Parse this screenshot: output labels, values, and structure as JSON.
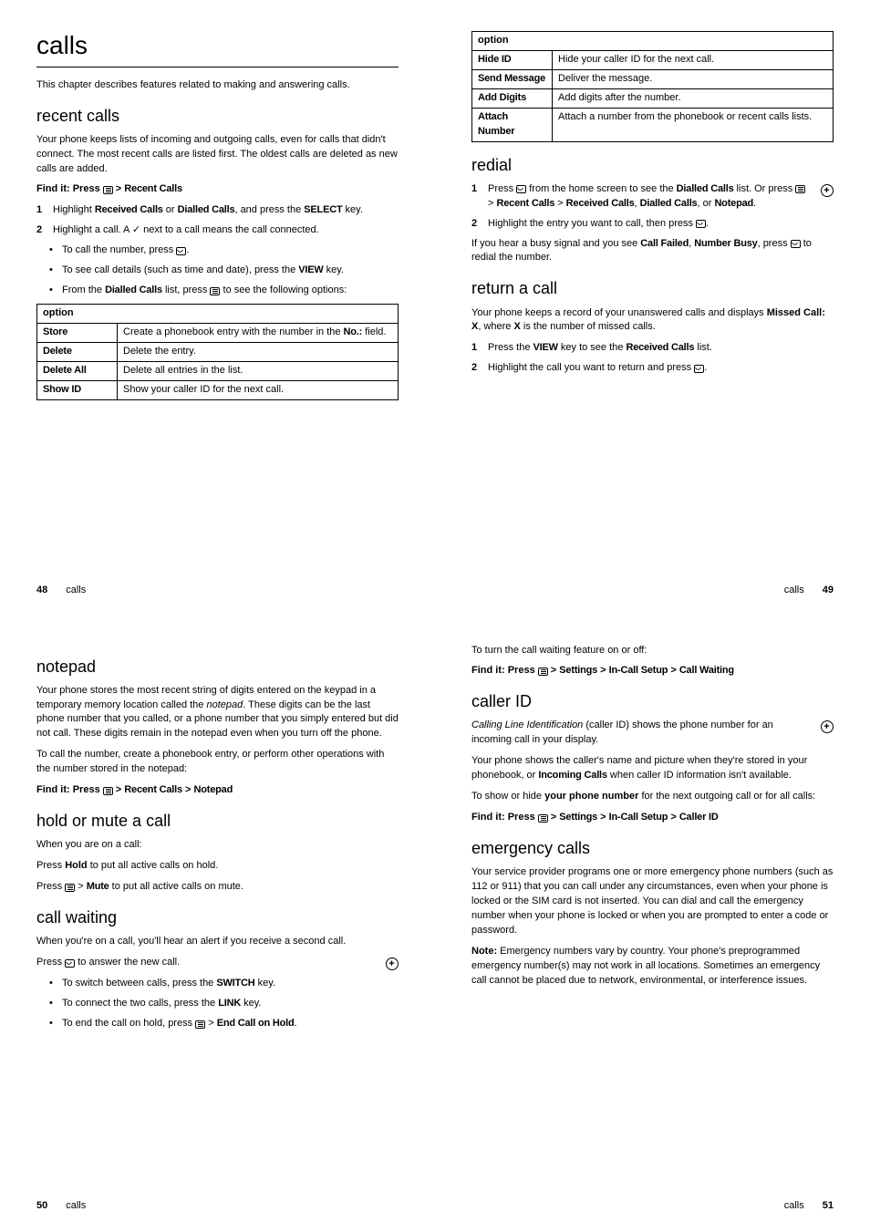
{
  "page48": {
    "h1": "calls",
    "intro": "This chapter describes features related to making and answering calls.",
    "h2": "recent calls",
    "p1": "Your phone keeps lists of incoming and outgoing calls, even for calls that didn't connect. The most recent calls are listed first. The oldest calls are deleted as new calls are added.",
    "find_label": "Find it:",
    "find_text1": " Press ",
    "find_text2": " > ",
    "find_recent": "Recent Calls",
    "step1_a": "Highlight ",
    "step1_b": "Received Calls",
    "step1_c": " or ",
    "step1_d": "Dialled Calls",
    "step1_e": ", and press the ",
    "step1_f": "SELECT",
    "step1_g": " key.",
    "step2_a": "Highlight a call. A ✓ next to a call means the call connected.",
    "bullet1_a": "To call the number, press ",
    "bullet1_b": ".",
    "bullet2_a": "To see call details (such as time and date), press the ",
    "bullet2_b": "VIEW",
    "bullet2_c": " key.",
    "bullet3_a": "From the ",
    "bullet3_b": "Dialled Calls",
    "bullet3_c": " list, press ",
    "bullet3_d": " to see the following options:",
    "table": {
      "header": "option",
      "rows": [
        {
          "opt": "Store",
          "desc_a": "Create a phonebook entry with the number in the ",
          "desc_b": "No.:",
          "desc_c": " field."
        },
        {
          "opt": "Delete",
          "desc_a": "Delete the entry."
        },
        {
          "opt": "Delete All",
          "desc_a": "Delete all entries in the list."
        },
        {
          "opt": "Show ID",
          "desc_a": "Show your caller ID for the next call."
        }
      ]
    },
    "pagenum": "48",
    "pagelabel": "calls"
  },
  "page49": {
    "table": {
      "header": "option",
      "rows": [
        {
          "opt": "Hide ID",
          "desc": "Hide your caller ID for the next call."
        },
        {
          "opt": "Send Message",
          "desc": "Deliver the message."
        },
        {
          "opt": "Add Digits",
          "desc": "Add digits after the number."
        },
        {
          "opt": "Attach Number",
          "desc": "Attach a number from the phonebook or recent calls lists."
        }
      ]
    },
    "h2a": "redial",
    "step1_a": "Press ",
    "step1_b": " from the home screen to see the ",
    "step1_c": "Dialled Calls",
    "step1_d": " list. Or press ",
    "step1_e": " > ",
    "step1_f": "Recent Calls",
    "step1_g": " > ",
    "step1_h": "Received Calls",
    "step1_i": ", ",
    "step1_j": "Dialled Calls",
    "step1_k": ", or ",
    "step1_l": "Notepad",
    "step1_m": ".",
    "step2_a": "Highlight the entry you want to call, then press ",
    "step2_b": ".",
    "busy_a": "If you hear a busy signal and you see ",
    "busy_b": "Call Failed",
    "busy_c": ", ",
    "busy_d": "Number Busy",
    "busy_e": ", press ",
    "busy_f": " to redial the number.",
    "h2b": "return a call",
    "ret_p_a": "Your phone keeps a record of your unanswered calls and displays ",
    "ret_p_b": "Missed Call: X",
    "ret_p_c": ", where ",
    "ret_p_d": "X",
    "ret_p_e": " is the number of missed calls.",
    "ret_s1_a": "Press the ",
    "ret_s1_b": "VIEW",
    "ret_s1_c": " key to see the ",
    "ret_s1_d": "Received Calls",
    "ret_s1_e": " list.",
    "ret_s2_a": "Highlight the call you want to return and press ",
    "ret_s2_b": ".",
    "pagelabel": "calls",
    "pagenum": "49"
  },
  "page50": {
    "h2a": "notepad",
    "np_p1": "Your phone stores the most recent string of digits entered on the keypad in a temporary memory location called the ",
    "np_p1_em": "notepad",
    "np_p1_b": ". These digits can be the last phone number that you called, or a phone number that you simply entered but did not call. These digits remain in the notepad even when you turn off the phone.",
    "np_p2": "To call the number, create a phonebook entry, or perform other operations with the number stored in the notepad:",
    "find_label": "Find it:",
    "find_a": " Press ",
    "find_b": " > ",
    "find_c": "Recent Calls",
    "find_d": " > ",
    "find_e": "Notepad",
    "h2b": "hold or mute a call",
    "hm_p1": "When you are on a call:",
    "hm_p2_a": "Press ",
    "hm_p2_b": "Hold",
    "hm_p2_c": " to put all active calls on hold.",
    "hm_p3_a": "Press ",
    "hm_p3_b": " > ",
    "hm_p3_c": "Mute",
    "hm_p3_d": " to put all active calls on mute.",
    "h2c": "call waiting",
    "cw_p1": "When you're on a call, you'll hear an alert if you receive a second call.",
    "cw_p2_a": "Press ",
    "cw_p2_b": " to answer the new call.",
    "cw_b1_a": "To switch between calls, press the ",
    "cw_b1_b": "SWITCH",
    "cw_b1_c": " key.",
    "cw_b2_a": "To connect the two calls, press the ",
    "cw_b2_b": "LINK",
    "cw_b2_c": " key.",
    "cw_b3_a": "To end the call on hold, press ",
    "cw_b3_b": " > ",
    "cw_b3_c": "End Call on Hold",
    "cw_b3_d": ".",
    "pagenum": "50",
    "pagelabel": "calls"
  },
  "page51": {
    "cw_p1": "To turn the call waiting feature on or off:",
    "find1_label": "Find it:",
    "find1_a": " Press ",
    "find1_b": " > ",
    "find1_c": "Settings",
    "find1_d": " > ",
    "find1_e": "In-Call Setup",
    "find1_f": " > ",
    "find1_g": "Call Waiting",
    "h2a": "caller ID",
    "cid_p1_em": "Calling Line Identification",
    "cid_p1_a": " (caller ID) shows the phone number for an incoming call in your display.",
    "cid_p2_a": "Your phone shows the caller's name and picture when they're stored in your phonebook, or ",
    "cid_p2_b": "Incoming Calls",
    "cid_p2_c": " when caller ID information isn't available.",
    "cid_p3_a": "To show or hide ",
    "cid_p3_b": "your phone number",
    "cid_p3_c": " for the next outgoing call or for all calls:",
    "find2_label": "Find it:",
    "find2_a": " Press ",
    "find2_b": " > ",
    "find2_c": "Settings",
    "find2_d": " > ",
    "find2_e": "In-Call Setup",
    "find2_f": " > ",
    "find2_g": "Caller ID",
    "h2b": "emergency calls",
    "ec_p1": "Your service provider programs one or more emergency phone numbers (such as 112 or 911) that you can call under any circumstances, even when your phone is locked or the SIM card is not inserted. You can dial and call the emergency number when your phone is locked or when you are prompted to enter a code or password.",
    "ec_p2_a": "Note:",
    "ec_p2_b": " Emergency numbers vary by country. Your phone's preprogrammed emergency number(s) may not work in all locations. Sometimes an emergency call cannot be placed due to network, environmental, or interference issues.",
    "pagelabel": "calls",
    "pagenum": "51"
  }
}
